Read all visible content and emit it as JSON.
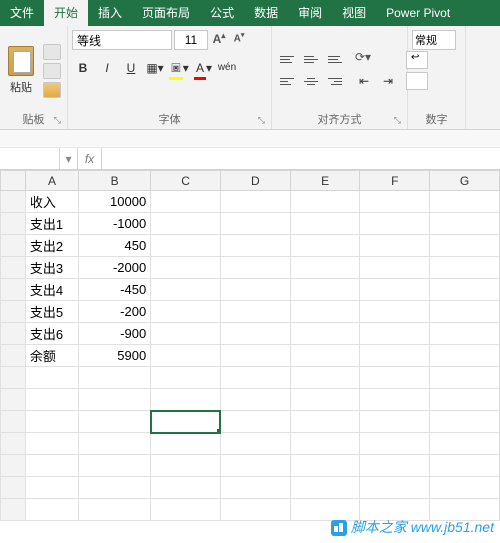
{
  "tabs": [
    "文件",
    "开始",
    "插入",
    "页面布局",
    "公式",
    "数据",
    "审阅",
    "视图",
    "Power Pivot"
  ],
  "active_tab_index": 1,
  "ribbon": {
    "clipboard": {
      "paste": "粘贴",
      "title": "贴板"
    },
    "font": {
      "title": "字体",
      "family": "等线",
      "size": "11",
      "bold": "B",
      "italic": "I",
      "underline": "U",
      "wen": "wén",
      "fill_color": "#ffff00",
      "text_color": "#ff0000"
    },
    "alignment": {
      "title": "对齐方式"
    },
    "number": {
      "title": "数字",
      "format": "常规"
    }
  },
  "name_box": "",
  "fx_label": "fx",
  "formula_value": "",
  "columns": [
    "A",
    "B",
    "C",
    "D",
    "E",
    "F",
    "G"
  ],
  "rows": [
    {
      "a": "收入",
      "b": "10000"
    },
    {
      "a": "支出1",
      "b": "-1000"
    },
    {
      "a": "支出2",
      "b": "450"
    },
    {
      "a": "支出3",
      "b": "-2000"
    },
    {
      "a": "支出4",
      "b": "-450"
    },
    {
      "a": "支出5",
      "b": "-200"
    },
    {
      "a": "支出6",
      "b": "-900"
    },
    {
      "a": "余额",
      "b": "5900"
    }
  ],
  "selected_cell": "C11",
  "watermark": "脚本之家 www.jb51.net"
}
